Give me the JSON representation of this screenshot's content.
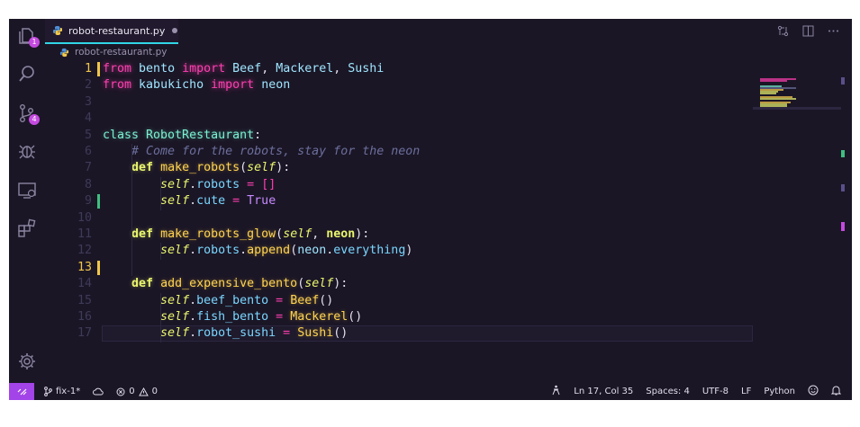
{
  "tab": {
    "filename": "robot-restaurant.py"
  },
  "breadcrumb": {
    "file": "robot-restaurant.py"
  },
  "activity_bar": {
    "explorer_badge": "1",
    "scm_badge": "4",
    "icons": [
      "files-icon",
      "search-icon",
      "source-control-icon",
      "debug-icon",
      "remote-explorer-icon",
      "extensions-icon",
      "settings-gear-icon"
    ]
  },
  "editor": {
    "current_line": 17,
    "lines": [
      {
        "n": "1",
        "tokens": [
          [
            "k",
            "from"
          ],
          [
            "pn",
            " "
          ],
          [
            "id",
            "bento"
          ],
          [
            "pn",
            " "
          ],
          [
            "k",
            "import"
          ],
          [
            "pn",
            " "
          ],
          [
            "id",
            "Beef"
          ],
          [
            "pn",
            ", "
          ],
          [
            "id",
            "Mackerel"
          ],
          [
            "pn",
            ", "
          ],
          [
            "id",
            "Sushi"
          ]
        ]
      },
      {
        "n": "2",
        "tokens": [
          [
            "k",
            "from"
          ],
          [
            "pn",
            " "
          ],
          [
            "id",
            "kabukicho"
          ],
          [
            "pn",
            " "
          ],
          [
            "k",
            "import"
          ],
          [
            "pn",
            " "
          ],
          [
            "id",
            "neon"
          ]
        ]
      },
      {
        "n": "3",
        "tokens": []
      },
      {
        "n": "4",
        "tokens": []
      },
      {
        "n": "5",
        "tokens": [
          [
            "cls",
            "class RobotRestaurant"
          ],
          [
            "pn",
            ":"
          ]
        ]
      },
      {
        "n": "6",
        "tokens": [
          [
            "pn",
            "    "
          ],
          [
            "cm",
            "# Come for the robots, stay for the neon"
          ]
        ]
      },
      {
        "n": "7",
        "tokens": [
          [
            "pn",
            "    "
          ],
          [
            "def",
            "def"
          ],
          [
            "pn",
            " "
          ],
          [
            "fn",
            "make_robots"
          ],
          [
            "pn",
            "("
          ],
          [
            "self",
            "self"
          ],
          [
            "pn",
            "):"
          ]
        ]
      },
      {
        "n": "8",
        "tokens": [
          [
            "pn",
            "        "
          ],
          [
            "self",
            "self"
          ],
          [
            "pn",
            "."
          ],
          [
            "attr",
            "robots"
          ],
          [
            "pn",
            " "
          ],
          [
            "op",
            "="
          ],
          [
            "pn",
            " "
          ],
          [
            "op",
            "[]"
          ]
        ]
      },
      {
        "n": "9",
        "tokens": [
          [
            "pn",
            "        "
          ],
          [
            "self",
            "self"
          ],
          [
            "pn",
            "."
          ],
          [
            "attr",
            "cute"
          ],
          [
            "pn",
            " "
          ],
          [
            "op",
            "="
          ],
          [
            "pn",
            " "
          ],
          [
            "const",
            "True"
          ]
        ]
      },
      {
        "n": "10",
        "tokens": []
      },
      {
        "n": "11",
        "tokens": [
          [
            "pn",
            "    "
          ],
          [
            "def",
            "def"
          ],
          [
            "pn",
            " "
          ],
          [
            "fn",
            "make_robots_glow"
          ],
          [
            "pn",
            "("
          ],
          [
            "self",
            "self"
          ],
          [
            "pn",
            ", "
          ],
          [
            "par",
            "neon"
          ],
          [
            "pn",
            "):"
          ]
        ]
      },
      {
        "n": "12",
        "tokens": [
          [
            "pn",
            "        "
          ],
          [
            "self",
            "self"
          ],
          [
            "pn",
            "."
          ],
          [
            "attr",
            "robots"
          ],
          [
            "pn",
            "."
          ],
          [
            "fn",
            "append"
          ],
          [
            "pn",
            "("
          ],
          [
            "id",
            "neon"
          ],
          [
            "pn",
            "."
          ],
          [
            "attr",
            "everything"
          ],
          [
            "pn",
            ")"
          ]
        ]
      },
      {
        "n": "13",
        "tokens": []
      },
      {
        "n": "14",
        "tokens": [
          [
            "pn",
            "    "
          ],
          [
            "def",
            "def"
          ],
          [
            "pn",
            " "
          ],
          [
            "fn",
            "add_expensive_bento"
          ],
          [
            "pn",
            "("
          ],
          [
            "self",
            "self"
          ],
          [
            "pn",
            "):"
          ]
        ]
      },
      {
        "n": "15",
        "tokens": [
          [
            "pn",
            "        "
          ],
          [
            "self",
            "self"
          ],
          [
            "pn",
            "."
          ],
          [
            "attr",
            "beef_bento"
          ],
          [
            "pn",
            " "
          ],
          [
            "op",
            "="
          ],
          [
            "pn",
            " "
          ],
          [
            "fn",
            "Beef"
          ],
          [
            "pn",
            "()"
          ]
        ]
      },
      {
        "n": "16",
        "tokens": [
          [
            "pn",
            "        "
          ],
          [
            "self",
            "self"
          ],
          [
            "pn",
            "."
          ],
          [
            "attr",
            "fish_bento"
          ],
          [
            "pn",
            " "
          ],
          [
            "op",
            "="
          ],
          [
            "pn",
            " "
          ],
          [
            "fn",
            "Mackerel"
          ],
          [
            "pn",
            "()"
          ]
        ]
      },
      {
        "n": "17",
        "tokens": [
          [
            "pn",
            "        "
          ],
          [
            "self",
            "self"
          ],
          [
            "pn",
            "."
          ],
          [
            "attr",
            "robot_sushi"
          ],
          [
            "pn",
            " "
          ],
          [
            "op",
            "="
          ],
          [
            "pn",
            " "
          ],
          [
            "fn",
            "Sushi"
          ],
          [
            "pn",
            "()"
          ]
        ]
      }
    ]
  },
  "status": {
    "branch": "fix-1*",
    "errors": "0",
    "warnings": "0",
    "position": "Ln 17, Col 35",
    "indent": "Spaces: 4",
    "encoding": "UTF-8",
    "eol": "LF",
    "language": "Python"
  },
  "colors": {
    "accent": "#a244e8",
    "tab_underline": "#32d6e6",
    "background": "#1b1626",
    "keyword": "#ff3fb0",
    "function": "#ffd34f"
  }
}
